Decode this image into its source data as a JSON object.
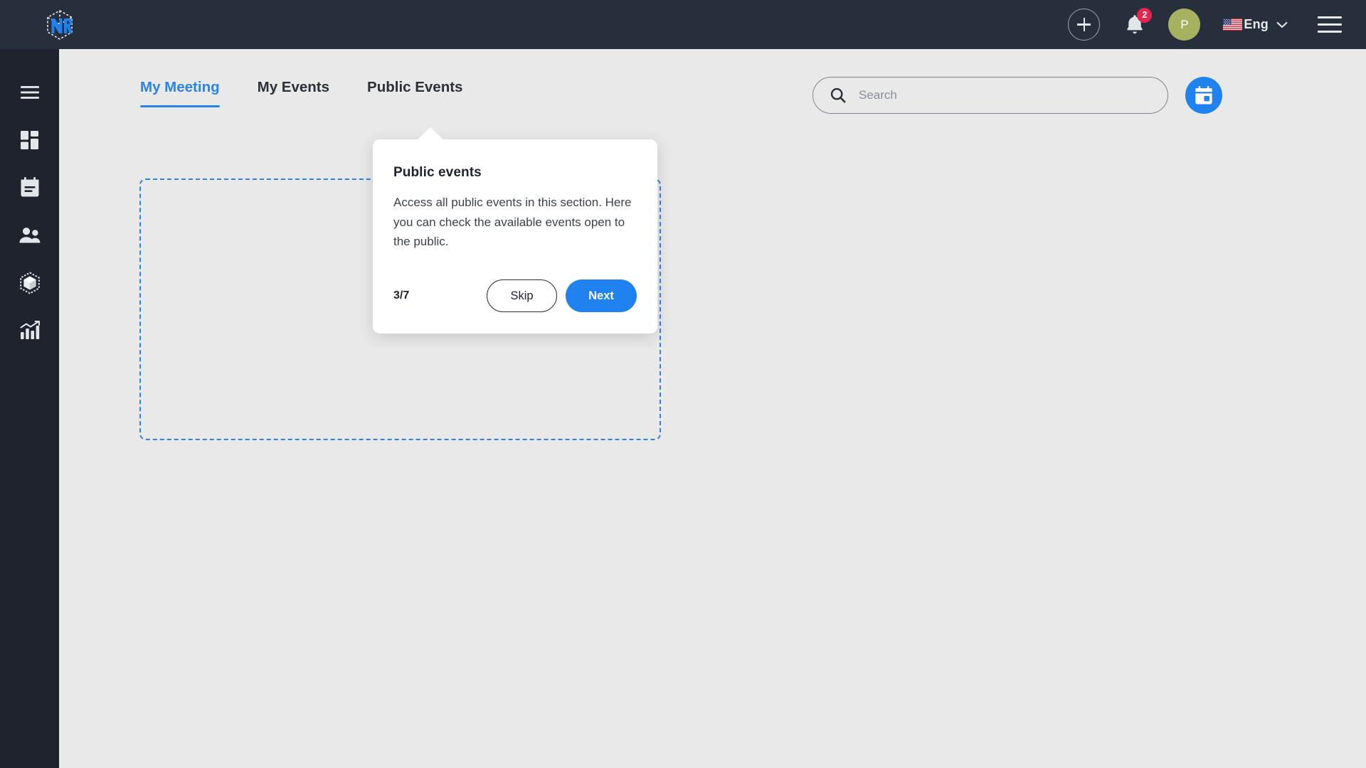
{
  "topbar": {
    "logo_name": "nr-cube-logo",
    "logo_text": "NR",
    "add_button_label": "+",
    "notifications": {
      "icon": "bell-icon",
      "badge_count": "2"
    },
    "avatar_initial": "P",
    "avatar_color": "#a6b25f",
    "language": {
      "flag": "us-flag-icon",
      "label": "Eng",
      "chevron": "chevron-down-icon"
    },
    "menu_icon": "hamburger-menu-icon"
  },
  "sidebar": {
    "items": [
      {
        "name": "menu-toggle",
        "icon": "hamburger-menu-icon"
      },
      {
        "name": "dashboard",
        "icon": "dashboard-grid-icon"
      },
      {
        "name": "events",
        "icon": "calendar-icon"
      },
      {
        "name": "contacts",
        "icon": "people-icon"
      },
      {
        "name": "packages",
        "icon": "cube-box-icon"
      },
      {
        "name": "analytics",
        "icon": "bar-chart-icon"
      }
    ]
  },
  "main": {
    "tabs": [
      {
        "label": "My Meeting",
        "active": true
      },
      {
        "label": "My Events",
        "active": false
      },
      {
        "label": "Public Events",
        "active": false
      }
    ],
    "search": {
      "icon": "search-icon",
      "placeholder": "Search",
      "value": ""
    },
    "calendar_button": {
      "icon": "calendar-icon",
      "color": "#1f82ef"
    },
    "highlight_region": {
      "name": "public-events-highlight",
      "border_color": "#2b82e8"
    }
  },
  "popover": {
    "title": "Public events",
    "body": "Access all public events in this section. Here you can check the available events open to the public.",
    "step": "3/7",
    "skip_label": "Skip",
    "next_label": "Next",
    "accent_color": "#1f82ef"
  },
  "colors": {
    "topbar_bg": "#272f3d",
    "sidebar_bg": "#1e232d",
    "content_bg": "#e9e9e9",
    "accent_blue": "#2b82e8",
    "badge_red": "#e5254f"
  }
}
